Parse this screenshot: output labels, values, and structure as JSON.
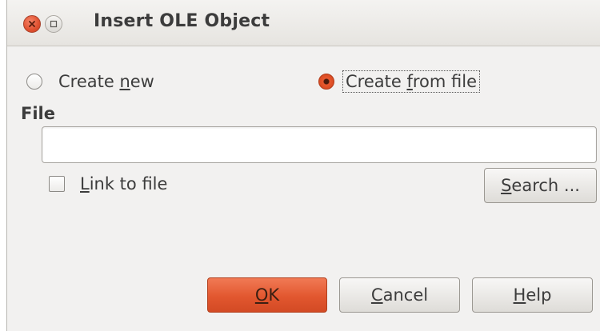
{
  "window": {
    "title": "Insert OLE Object",
    "close_icon": "close-icon",
    "maximize_icon": "maximize-icon"
  },
  "options": {
    "create_new": {
      "pre": "Create ",
      "key": "n",
      "post": "ew",
      "selected": false
    },
    "create_from_file": {
      "pre": "Create ",
      "key": "f",
      "post": "rom file",
      "selected": true
    }
  },
  "file": {
    "label": "File",
    "value": "",
    "placeholder": ""
  },
  "link": {
    "key": "L",
    "post": "ink to file",
    "checked": false
  },
  "buttons": {
    "search": {
      "key": "S",
      "post": "earch ..."
    },
    "ok": {
      "key": "O",
      "post": "K"
    },
    "cancel": {
      "key": "C",
      "post": "ancel"
    },
    "help": {
      "key": "H",
      "post": "elp"
    }
  },
  "colors": {
    "accent": "#e2572f",
    "window_bg": "#f2f1f0"
  }
}
